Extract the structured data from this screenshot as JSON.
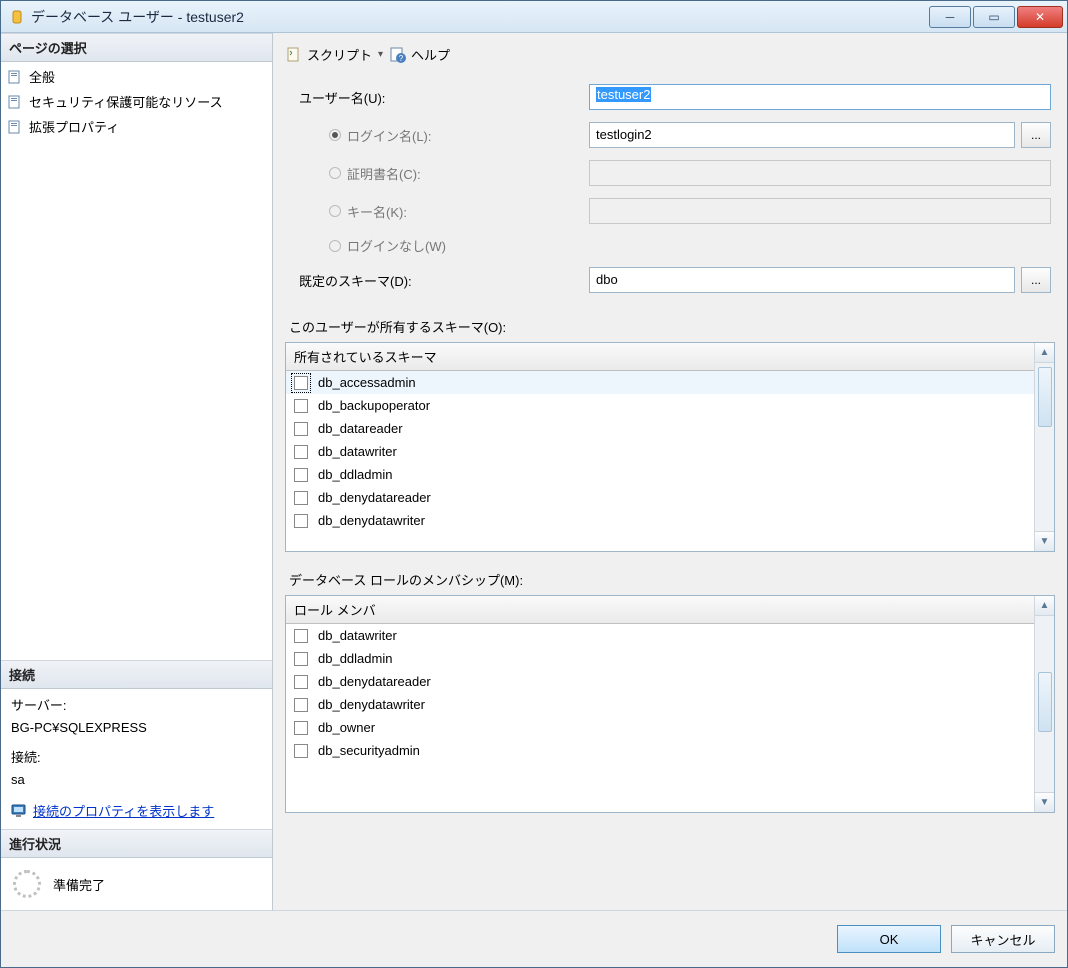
{
  "window": {
    "title": "データベース ユーザー - testuser2"
  },
  "win_buttons": {
    "min": "─",
    "max": "▭",
    "close": "✕"
  },
  "sidebar": {
    "page_select_header": "ページの選択",
    "items": [
      {
        "label": "全般"
      },
      {
        "label": "セキュリティ保護可能なリソース"
      },
      {
        "label": "拡張プロパティ"
      }
    ],
    "connection_header": "接続",
    "server_label": "サーバー:",
    "server_value": "BG-PC¥SQLEXPRESS",
    "conn_label": "接続:",
    "conn_value": "sa",
    "conn_props_link": "接続のプロパティを表示します",
    "progress_header": "進行状況",
    "progress_status": "準備完了"
  },
  "toolbar": {
    "script_label": "スクリプト",
    "dropdown_glyph": "▾",
    "help_label": "ヘルプ"
  },
  "form": {
    "user_name_label": "ユーザー名(U):",
    "user_name_value": "testuser2",
    "login_name_label": "ログイン名(L):",
    "login_name_value": "testlogin2",
    "cert_name_label": "証明書名(C):",
    "cert_name_value": "",
    "key_name_label": "キー名(K):",
    "key_name_value": "",
    "no_login_label": "ログインなし(W)",
    "default_schema_label": "既定のスキーマ(D):",
    "default_schema_value": "dbo",
    "ellipsis": "..."
  },
  "owned_schemas": {
    "section_label": "このユーザーが所有するスキーマ(O):",
    "header": "所有されているスキーマ",
    "items": [
      "db_accessadmin",
      "db_backupoperator",
      "db_datareader",
      "db_datawriter",
      "db_ddladmin",
      "db_denydatareader",
      "db_denydatawriter"
    ]
  },
  "role_membership": {
    "section_label": "データベース ロールのメンバシップ(M):",
    "header": "ロール メンバ",
    "items": [
      "db_datawriter",
      "db_ddladmin",
      "db_denydatareader",
      "db_denydatawriter",
      "db_owner",
      "db_securityadmin"
    ]
  },
  "footer": {
    "ok": "OK",
    "cancel": "キャンセル"
  },
  "scroll": {
    "up": "▲",
    "down": "▼"
  }
}
